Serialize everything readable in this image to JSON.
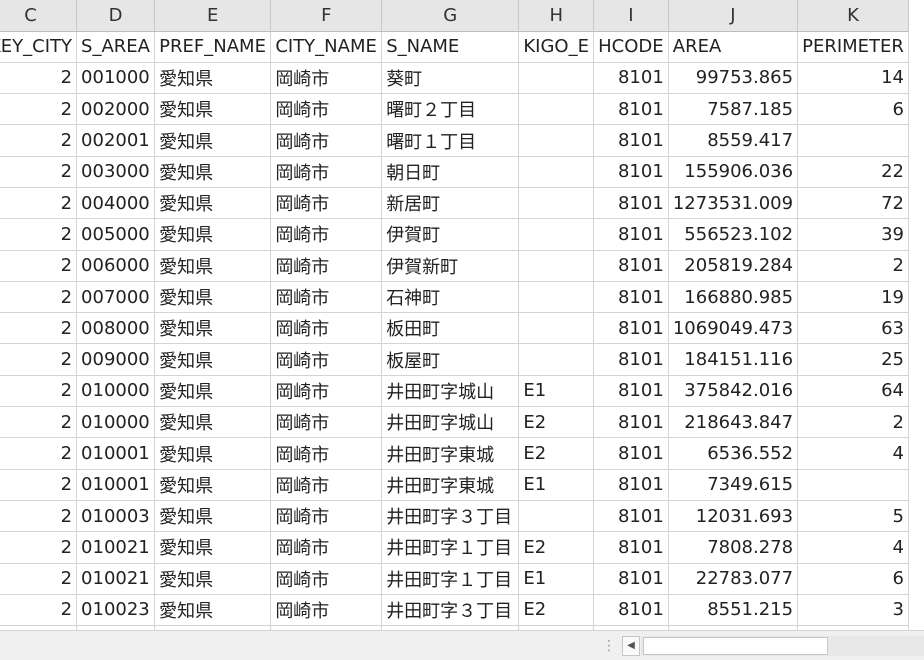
{
  "sheet": {
    "column_letters": [
      "C",
      "D",
      "E",
      "F",
      "G",
      "H",
      "I",
      "J",
      "K"
    ],
    "header_row": [
      "KEY_CITY",
      "S_AREA",
      "PREF_NAME",
      "CITY_NAME",
      "S_NAME",
      "KIGO_E",
      "HCODE",
      "AREA",
      "PERIMETER"
    ],
    "rows": [
      [
        "2",
        "001000",
        "愛知県",
        "岡崎市",
        "葵町",
        "",
        "8101",
        "99753.865",
        "14"
      ],
      [
        "2",
        "002000",
        "愛知県",
        "岡崎市",
        "曙町２丁目",
        "",
        "8101",
        "7587.185",
        "6"
      ],
      [
        "2",
        "002001",
        "愛知県",
        "岡崎市",
        "曙町１丁目",
        "",
        "8101",
        "8559.417",
        ""
      ],
      [
        "2",
        "003000",
        "愛知県",
        "岡崎市",
        "朝日町",
        "",
        "8101",
        "155906.036",
        "22"
      ],
      [
        "2",
        "004000",
        "愛知県",
        "岡崎市",
        "新居町",
        "",
        "8101",
        "1273531.009",
        "72"
      ],
      [
        "2",
        "005000",
        "愛知県",
        "岡崎市",
        "伊賀町",
        "",
        "8101",
        "556523.102",
        "39"
      ],
      [
        "2",
        "006000",
        "愛知県",
        "岡崎市",
        "伊賀新町",
        "",
        "8101",
        "205819.284",
        "2"
      ],
      [
        "2",
        "007000",
        "愛知県",
        "岡崎市",
        "石神町",
        "",
        "8101",
        "166880.985",
        "19"
      ],
      [
        "2",
        "008000",
        "愛知県",
        "岡崎市",
        "板田町",
        "",
        "8101",
        "1069049.473",
        "63"
      ],
      [
        "2",
        "009000",
        "愛知県",
        "岡崎市",
        "板屋町",
        "",
        "8101",
        "184151.116",
        "25"
      ],
      [
        "2",
        "010000",
        "愛知県",
        "岡崎市",
        "井田町字城山",
        "E1",
        "8101",
        "375842.016",
        "64"
      ],
      [
        "2",
        "010000",
        "愛知県",
        "岡崎市",
        "井田町字城山",
        "E2",
        "8101",
        "218643.847",
        "2"
      ],
      [
        "2",
        "010001",
        "愛知県",
        "岡崎市",
        "井田町字東城",
        "E2",
        "8101",
        "6536.552",
        "4"
      ],
      [
        "2",
        "010001",
        "愛知県",
        "岡崎市",
        "井田町字東城",
        "E1",
        "8101",
        "7349.615",
        ""
      ],
      [
        "2",
        "010003",
        "愛知県",
        "岡崎市",
        "井田町字３丁目",
        "",
        "8101",
        "12031.693",
        "5"
      ],
      [
        "2",
        "010021",
        "愛知県",
        "岡崎市",
        "井田町字１丁目",
        "E2",
        "8101",
        "7808.278",
        "4"
      ],
      [
        "2",
        "010021",
        "愛知県",
        "岡崎市",
        "井田町字１丁目",
        "E1",
        "8101",
        "22783.077",
        "6"
      ],
      [
        "2",
        "010023",
        "愛知県",
        "岡崎市",
        "井田町字３丁目",
        "E2",
        "8101",
        "8551.215",
        "3"
      ],
      [
        "",
        "",
        "",
        "",
        "",
        "",
        "",
        "",
        ""
      ]
    ]
  },
  "scrollbar": {
    "split_handle": "⋮",
    "left_arrow": "◀"
  }
}
